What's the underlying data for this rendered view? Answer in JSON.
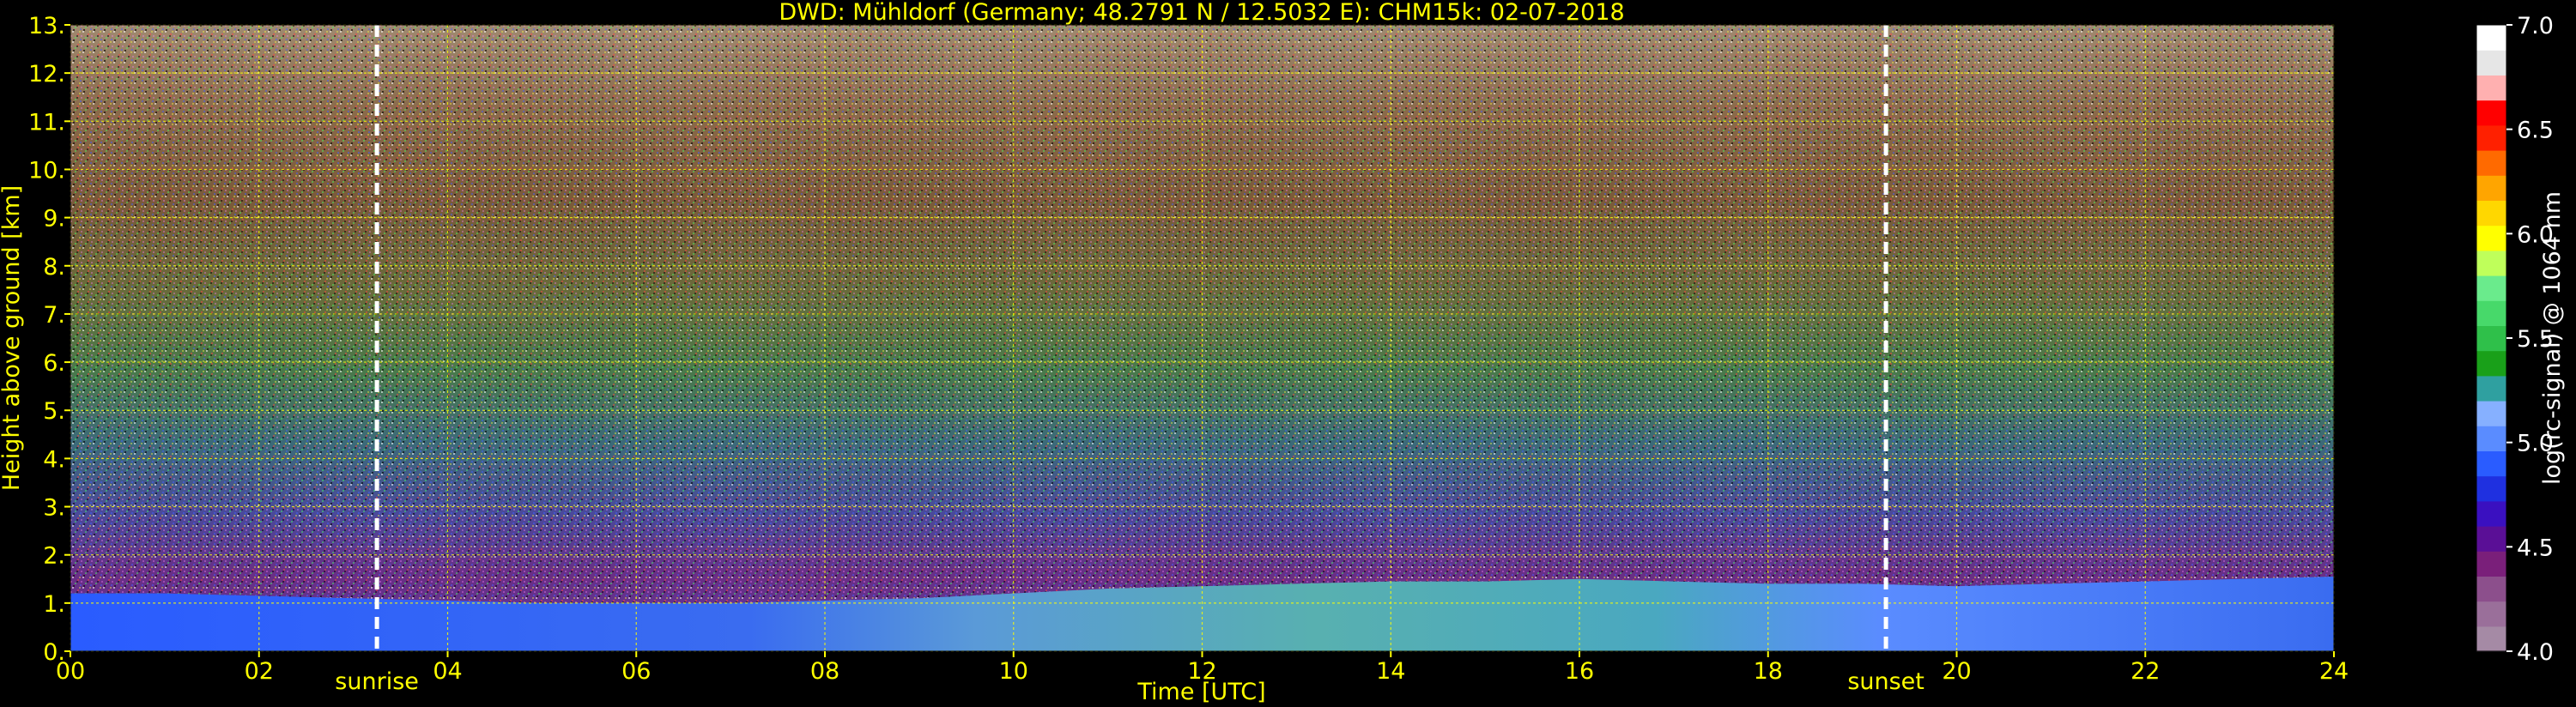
{
  "chart_data": {
    "type": "heatmap",
    "title": "DWD: Mühldorf (Germany; 48.2791 N / 12.5032 E):    CHM15k: 02-07-2018",
    "xlabel": "Time [UTC]",
    "ylabel": "Height above ground [km]",
    "xlim": [
      0,
      24
    ],
    "ylim": [
      0,
      13
    ],
    "x_ticks": [
      0,
      2,
      4,
      6,
      8,
      10,
      12,
      14,
      16,
      18,
      20,
      22,
      24
    ],
    "x_tick_labels": [
      "00",
      "02",
      "04",
      "06",
      "08",
      "10",
      "12",
      "14",
      "16",
      "18",
      "20",
      "22",
      "24"
    ],
    "y_ticks": [
      0,
      1,
      2,
      3,
      4,
      5,
      6,
      7,
      8,
      9,
      10,
      11,
      12,
      13
    ],
    "y_tick_labels": [
      "0.",
      "1.",
      "2.",
      "3.",
      "4.",
      "5.",
      "6.",
      "7.",
      "8.",
      "9.",
      "10.",
      "11.",
      "12.",
      "13."
    ],
    "grid": true,
    "annotations": [
      {
        "label": "sunrise",
        "time": 3.25
      },
      {
        "label": "sunset",
        "time": 19.25
      }
    ],
    "boundary_layer_top_km": {
      "time": [
        0,
        1,
        2,
        3,
        4,
        5,
        6,
        7,
        8,
        9,
        10,
        11,
        12,
        13,
        14,
        15,
        16,
        17,
        18,
        19,
        20,
        21,
        22,
        23,
        24
      ],
      "height": [
        1.2,
        1.2,
        1.15,
        1.1,
        1.05,
        1.0,
        1.0,
        1.0,
        1.05,
        1.1,
        1.2,
        1.3,
        1.35,
        1.4,
        1.45,
        1.45,
        1.5,
        1.45,
        1.4,
        1.4,
        1.35,
        1.4,
        1.45,
        1.5,
        1.55
      ]
    },
    "colorbar": {
      "label": "log(rc-signal) @ 1064 nm",
      "min": 4.0,
      "max": 7.0,
      "tick_values": [
        4.0,
        4.5,
        5.0,
        5.5,
        6.0,
        6.5,
        7.0
      ],
      "tick_labels": [
        "4.0",
        "4.5",
        "5.0",
        "5.5",
        "6.0",
        "6.5",
        "7.0"
      ],
      "colors": [
        "#a58aa5",
        "#9a6f9a",
        "#8c4f8c",
        "#7a1f7a",
        "#5a0f96",
        "#3a10c0",
        "#1f30e0",
        "#2a5cff",
        "#5a8cff",
        "#86b0ff",
        "#2fa0a0",
        "#19a019",
        "#2fc04a",
        "#47d96a",
        "#6aeb8c",
        "#bfff5a",
        "#ffff00",
        "#ffd700",
        "#ffa500",
        "#ff6a00",
        "#ff2000",
        "#ff0000",
        "#ffb0b0",
        "#e6e6e6",
        "#ffffff"
      ]
    }
  }
}
